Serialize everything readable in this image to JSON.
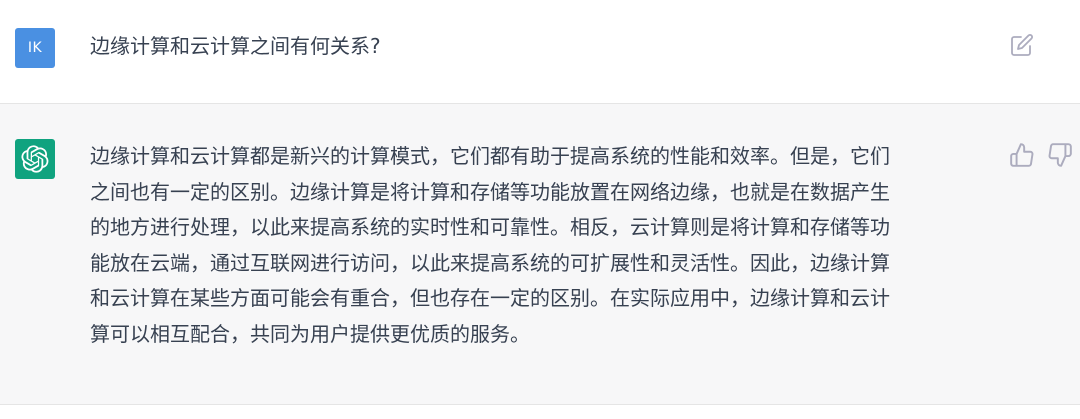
{
  "user": {
    "avatar_initials": "IK",
    "avatar_color": "#4a90e2",
    "message": "边缘计算和云计算之间有何关系?",
    "edit_icon": "edit-icon"
  },
  "assistant": {
    "avatar_icon": "openai-logo-icon",
    "avatar_color": "#10a37f",
    "message_lines": [
      "边缘计算和云计算都是新兴的计算模式，它们都有助于提高系统的性能和效率。但是，它们",
      "之间也有一定的区别。边缘计算是将计算和存储等功能放置在网络边缘，也就是在数据产生",
      "的地方进行处理，以此来提高系统的实时性和可靠性。相反，云计算则是将计算和存储等功",
      "能放在云端，通过互联网进行访问，以此来提高系统的可扩展性和灵活性。因此，边缘计算",
      "和云计算在某些方面可能会有重合，但也存在一定的区别。在实际应用中，边缘计算和云计",
      "算可以相互配合，共同为用户提供更优质的服务。"
    ],
    "feedback_icons": [
      "thumbs-up-icon",
      "thumbs-down-icon"
    ],
    "background": "#f7f7f8"
  }
}
